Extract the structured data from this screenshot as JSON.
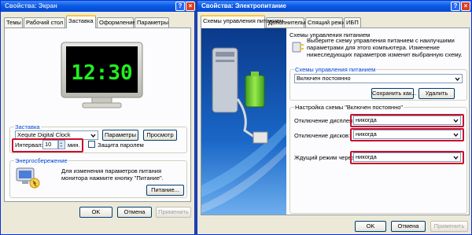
{
  "screen_props": {
    "title": "Свойства: Экран",
    "tabs": [
      "Темы",
      "Рабочий стол",
      "Заставка",
      "Оформление",
      "Параметры"
    ],
    "active_tab": "Заставка",
    "preview_time": "12:30",
    "screensaver_group_label": "Заставка",
    "screensaver_value": "Xequte Digital Clock",
    "settings_button": "Параметры",
    "preview_button": "Просмотр",
    "interval_label": "Интервал:",
    "interval_value": "10",
    "interval_unit": "мин.",
    "password_label": "Защита паролем",
    "power_group_label": "Энергосбережение",
    "power_desc": "Для изменения параметров питания монитора нажмите кнопку \"Питание\".",
    "power_button": "Питание...",
    "ok": "OK",
    "cancel": "Отмена",
    "apply": "Применить"
  },
  "power_props": {
    "title": "Свойства: Электропитание",
    "tabs": [
      "Схемы управления питанием",
      "Дополнительно",
      "Спящий режим",
      "ИБП"
    ],
    "active_tab": "Схемы управления питанием",
    "schemes_desc": "Выберите схему управления питанием с наилучшими параметрами для этого компьютера. Изменение нижеследующих параметров изменит выбранную схему.",
    "schemes_group_label": "Схемы управления питанием",
    "scheme_value": "Включен постоянно",
    "save_as_button": "Сохранить как...",
    "delete_button": "Удалить",
    "settings_group_label": "Настройка схемы \"Включен постоянно\"",
    "display_off_label": "Отключение дисплея:",
    "display_off_value": "никогда",
    "disks_off_label": "Отключение дисков:",
    "disks_off_value": "никогда",
    "standby_label": "Ждущий режим через:",
    "standby_value": "никогда",
    "ok": "OK",
    "cancel": "Отмена",
    "apply": "Применить"
  },
  "colors": {
    "title_bar": "#0a5ae6",
    "highlight_box": "#c8102e",
    "clock_digits": "#22ee22",
    "selection": "#316ac5"
  }
}
